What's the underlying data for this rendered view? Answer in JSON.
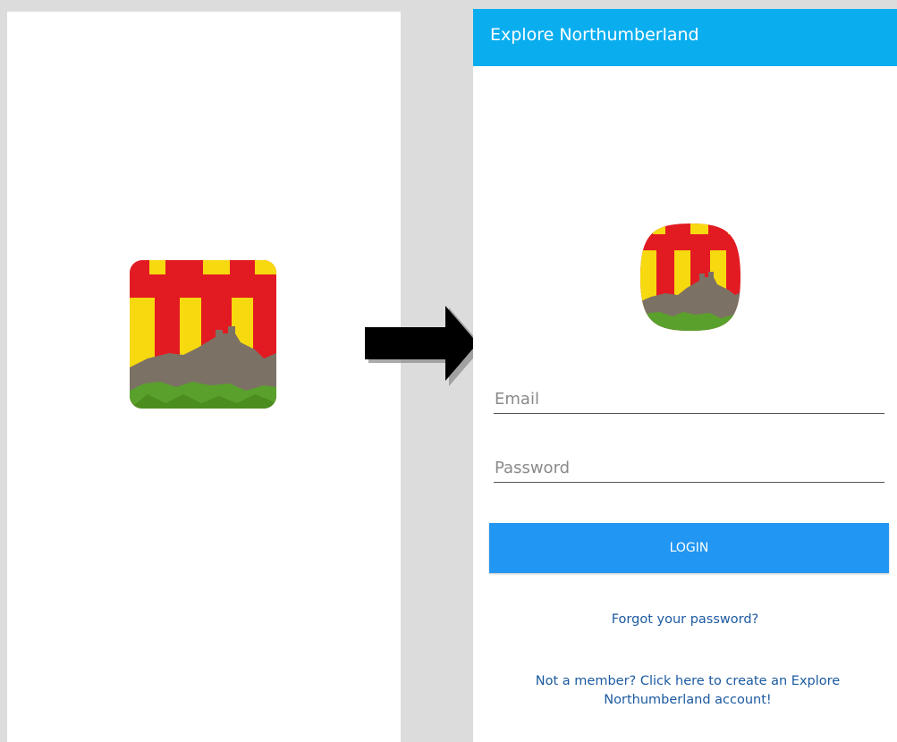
{
  "colors": {
    "appbar": "#0aaeef",
    "login_button": "#2196f3",
    "link": "#1c5aa0",
    "icon_red": "#e21b23",
    "icon_yellow": "#f7d90f",
    "icon_castle": "#7c7165",
    "icon_grass": "#5aa02c"
  },
  "splash": {
    "icon": "northumberland-flag-castle-icon"
  },
  "arrow": {
    "icon": "right-arrow-icon"
  },
  "login_screen": {
    "app_title": "Explore Northumberland",
    "icon": "northumberland-flag-castle-icon",
    "email": {
      "placeholder": "Email",
      "value": ""
    },
    "password": {
      "placeholder": "Password",
      "value": ""
    },
    "login_label": "LOGIN",
    "forgot_password_text": "Forgot your password?",
    "signup_text": "Not a member? Click here to create an Explore Northumberland account!"
  }
}
